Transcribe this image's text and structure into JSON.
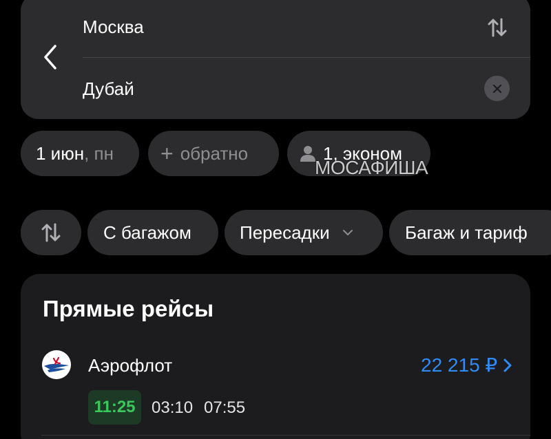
{
  "route": {
    "from": "Москва",
    "to": "Дубай"
  },
  "pills": {
    "date_main": "1 июн",
    "date_day": ", пн",
    "return_plus": "+",
    "return_label": "обратно",
    "passengers": "1, эконом"
  },
  "watermark": "МОСАФИША",
  "filters": {
    "baggage": "С багажом",
    "transfers": "Пересадки",
    "tariff": "Багаж и тариф"
  },
  "results": {
    "title": "Прямые рейсы",
    "flight": {
      "airline": "Аэрофлот",
      "price": "22 215 ₽",
      "times": [
        "11:25",
        "03:10",
        "07:55"
      ]
    }
  },
  "colors": {
    "background": "#000000",
    "card": "#2c2c2e",
    "results_card": "#1c1c1e",
    "accent_blue": "#2f8cf7",
    "accent_green": "#3ac85c",
    "muted": "#8e8e93"
  },
  "icons": {
    "back": "chevron-left-icon",
    "swap": "swap-vertical-icon",
    "clear": "close-icon",
    "passenger": "person-icon",
    "sort": "sort-icon",
    "dropdown": "chevron-down-icon",
    "price_arrow": "chevron-right-icon",
    "airline": "aeroflot-logo"
  }
}
